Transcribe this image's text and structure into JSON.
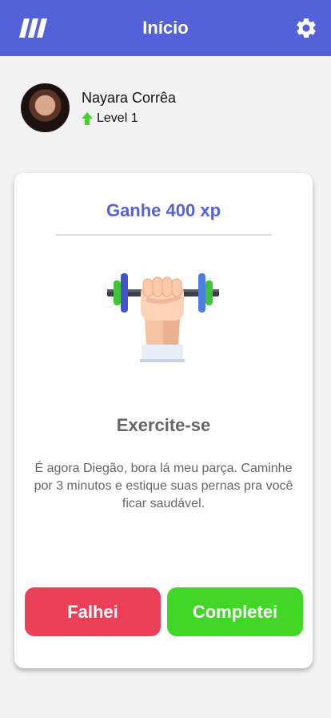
{
  "header": {
    "title": "Início",
    "logo_icon": "logo-slashes-icon",
    "settings_icon": "gear-icon",
    "background": "#5561d9"
  },
  "profile": {
    "name": "Nayara Corrêa",
    "level_label": "Level 1",
    "level_icon": "arrow-up-icon"
  },
  "task": {
    "reward": "Ganhe 400 xp",
    "illustration": "dumbbell-icon",
    "title": "Exercite-se",
    "description": "É agora Diegão, bora lá meu parça. Caminhe por 3 minutos e estique suas pernas pra você ficar saudável."
  },
  "actions": {
    "fail_label": "Falhei",
    "complete_label": "Completei"
  },
  "colors": {
    "accent": "#5561d9",
    "fail": "#eb4058",
    "success": "#41d628",
    "level_arrow": "#41d628"
  }
}
